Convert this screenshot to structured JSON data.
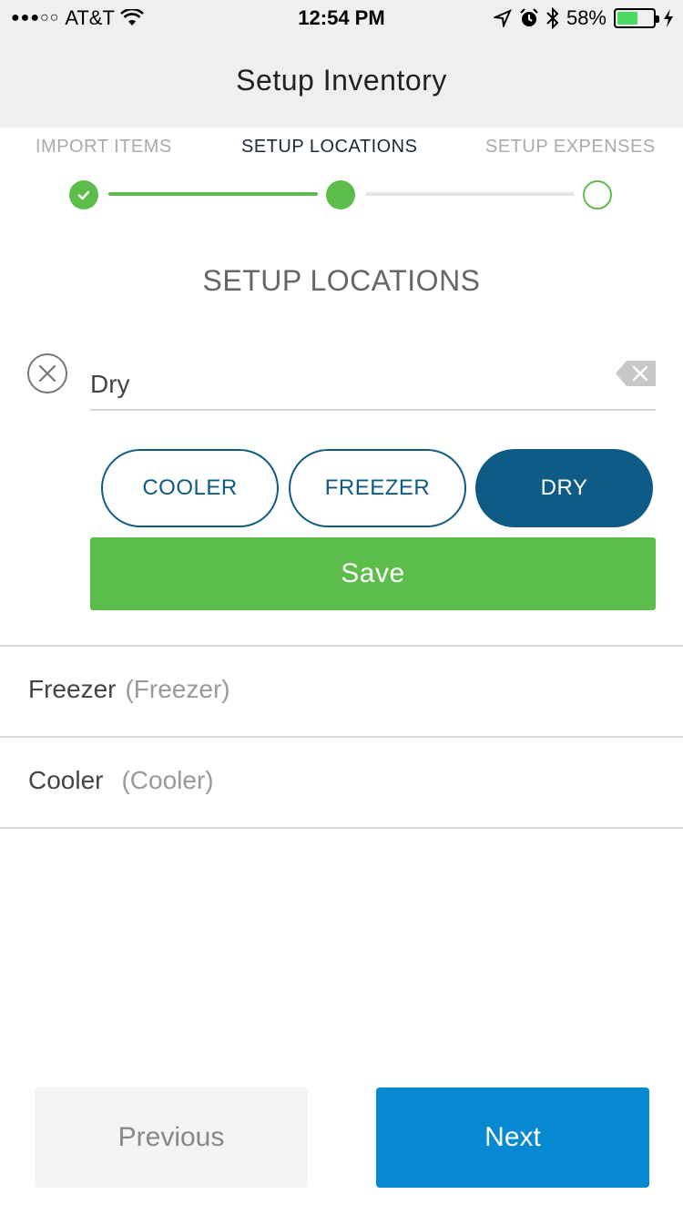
{
  "status_bar": {
    "carrier": "AT&T",
    "time": "12:54 PM",
    "battery_percent": "58%",
    "battery_level": 0.58,
    "icons": [
      "signal-dots-icon",
      "wifi-icon",
      "location-arrow-icon",
      "alarm-icon",
      "bluetooth-icon",
      "battery-icon",
      "charging-bolt-icon"
    ]
  },
  "header": {
    "title": "Setup Inventory"
  },
  "stepper": {
    "steps": [
      {
        "label": "IMPORT ITEMS",
        "state": "completed"
      },
      {
        "label": "SETUP LOCATIONS",
        "state": "active"
      },
      {
        "label": "SETUP EXPENSES",
        "state": "pending"
      }
    ],
    "colors": {
      "done": "#5cbd4a",
      "pending_line": "#e5e5e5"
    }
  },
  "section_title": "SETUP LOCATIONS",
  "location_input": {
    "value": "Dry",
    "placeholder": ""
  },
  "type_options": [
    {
      "label": "COOLER",
      "selected": false
    },
    {
      "label": "FREEZER",
      "selected": false
    },
    {
      "label": "DRY",
      "selected": true
    }
  ],
  "save_label": "Save",
  "locations": [
    {
      "name": "Freezer",
      "type": "(Freezer)"
    },
    {
      "name": "Cooler",
      "type": "(Cooler)"
    }
  ],
  "footer": {
    "previous_label": "Previous",
    "next_label": "Next"
  },
  "colors": {
    "accent_blue": "#0e5b85",
    "save_green": "#5cbd4a",
    "next_blue": "#0789d1"
  }
}
